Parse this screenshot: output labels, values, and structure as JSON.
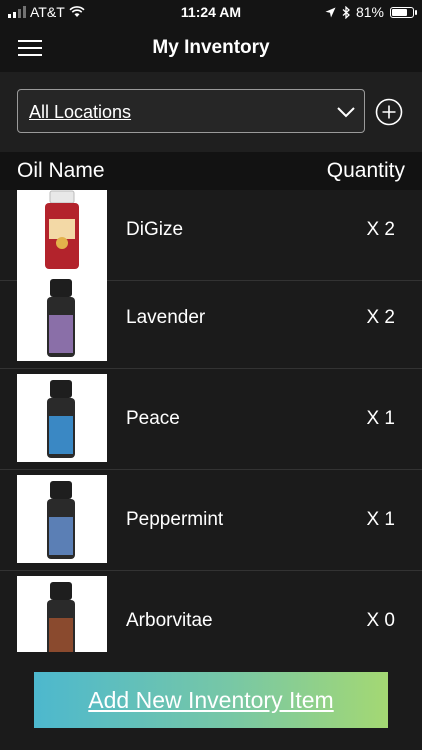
{
  "status_bar": {
    "carrier": "AT&T",
    "time": "11:24 AM",
    "battery": "81%",
    "battery_level": 0.81
  },
  "nav": {
    "title": "My Inventory",
    "menu_icon": "hamburger-menu-icon"
  },
  "filter": {
    "location": "All Locations",
    "chevron_icon": "chevron-down-icon",
    "add_icon": "plus-circle-icon"
  },
  "table": {
    "col_name": "Oil Name",
    "col_qty": "Quantity"
  },
  "items": [
    {
      "name": "DiGize",
      "qty": "X 2",
      "bottle_color": "#b3232c"
    },
    {
      "name": "Lavender",
      "qty": "X 2",
      "bottle_color": "#8a6fa8"
    },
    {
      "name": "Peace",
      "qty": "X 1",
      "bottle_color": "#3a88c4"
    },
    {
      "name": "Peppermint",
      "qty": "X 1",
      "bottle_color": "#5b7fb5"
    },
    {
      "name": "Arborvitae",
      "qty": "X 0",
      "bottle_color": "#8a4a2e"
    }
  ],
  "footer": {
    "add_button": "Add New Inventory Item"
  },
  "colors": {
    "background": "#1b1b1b",
    "nav_background": "#141414",
    "button_gradient_start": "#4db8ce",
    "button_gradient_end": "#a4d873"
  }
}
